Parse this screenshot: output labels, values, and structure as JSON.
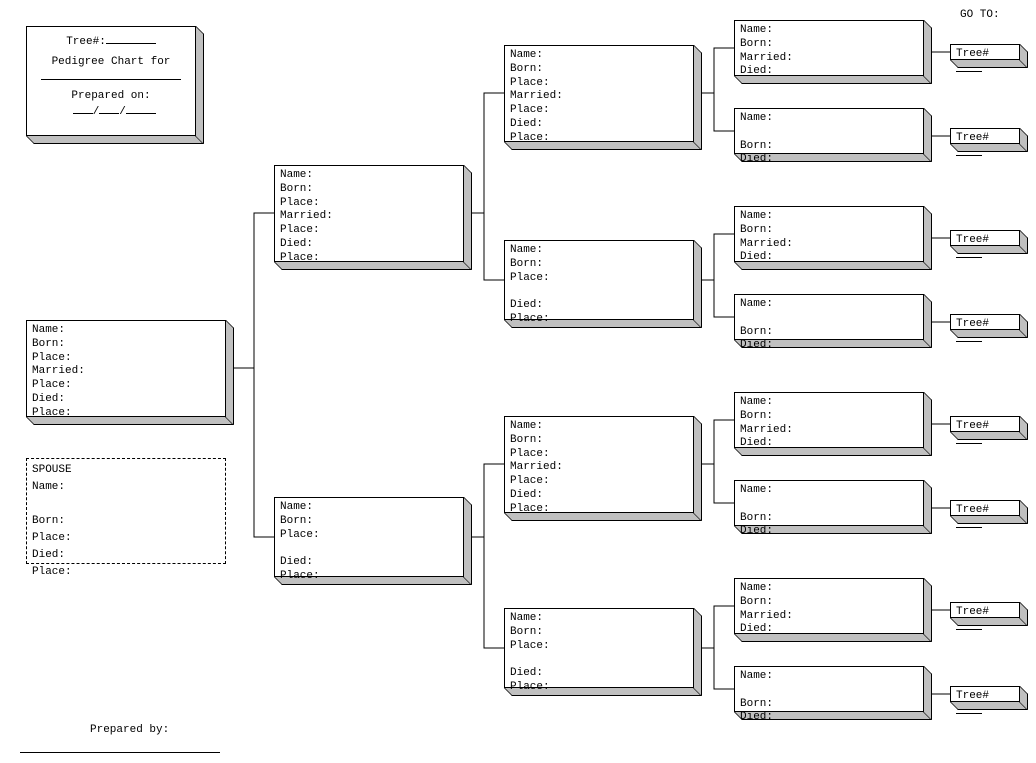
{
  "header": {
    "tree_label": "Tree#:",
    "title": "Pedigree Chart for",
    "prepared_on": "Prepared on:",
    "date_sep": "/",
    "prepared_by": "Prepared by:",
    "goto": "GO TO:",
    "tree_link": "Tree#"
  },
  "labels": {
    "name": "Name:",
    "born": "Born:",
    "place": "Place:",
    "married": "Married:",
    "died": "Died:",
    "spouse": "SPOUSE"
  }
}
